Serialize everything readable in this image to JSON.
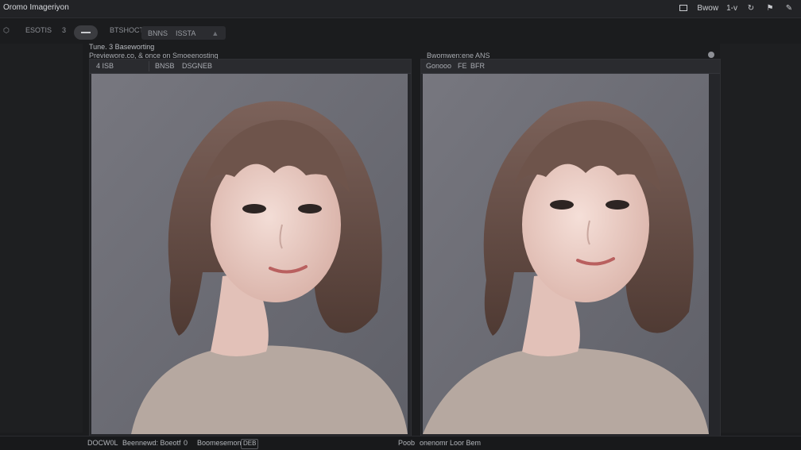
{
  "app": {
    "title": "Oromo Imageriyon"
  },
  "titlebar": {
    "view_label": "Bwow",
    "zoom_label": "1-v"
  },
  "toolbar": {
    "tool1": "ESOTIS",
    "tool2": "3",
    "tool3": "BTSHOCT",
    "group_a": "BNNS",
    "group_b": "ISSTA"
  },
  "content": {
    "breadcrumb": "Tune. 3 Baseworting",
    "subline": "Previewore.co, & once on Smoeenosting",
    "left_panel": {
      "head_a": "4 ISB",
      "head_b": "BNSB",
      "head_c": "DSGNEB"
    },
    "right_caption": "Bwomwen:ene ANS",
    "right_panel": {
      "head_a": "Gonooo",
      "head_b": "FE",
      "head_c": "BFR"
    }
  },
  "statusbar": {
    "item1": "DOCW0L",
    "item2": "Beennewd: Boeotf",
    "item3": "0",
    "item4": "Boomesemon",
    "item5": "DEB",
    "item6": "Poob",
    "item7": "onenomr Loor Bem"
  },
  "colors": {
    "background": "#1b1c1e",
    "panel": "#25262a",
    "image_backdrop": "#6d6e76",
    "hair": "#6b5148",
    "skin": "#e9cbc3",
    "sweater": "#b9aba2"
  },
  "icons": {
    "titlebar": [
      "chat-icon",
      "refresh-icon",
      "pin-icon",
      "pen-icon"
    ],
    "toolbar": [
      "layers-icon",
      "arrow-icon",
      "minus-icon",
      "dropdown-icon"
    ]
  }
}
